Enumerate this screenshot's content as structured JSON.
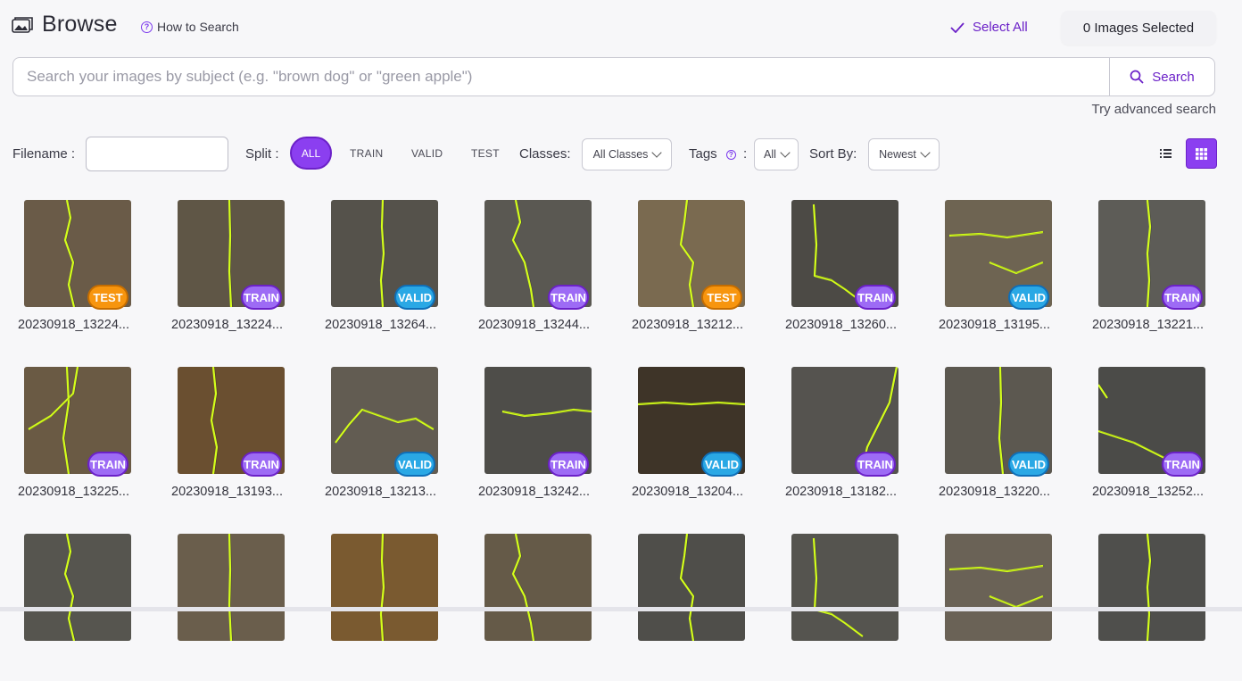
{
  "header": {
    "title": "Browse",
    "how_to_search": "How to Search",
    "select_all": "Select All",
    "selected_count": "0 Images Selected"
  },
  "search": {
    "placeholder": "Search your images by subject (e.g. \"brown dog\" or \"green apple\")",
    "value": "",
    "button_label": "Search",
    "advanced_link": "Try advanced search"
  },
  "filters": {
    "filename_label": "Filename :",
    "filename_value": "",
    "split_label": "Split :",
    "split_options": [
      "ALL",
      "TRAIN",
      "VALID",
      "TEST"
    ],
    "split_selected": "ALL",
    "classes_label": "Classes:",
    "classes_value": "All Classes",
    "tags_label": "Tags",
    "tags_colon": ":",
    "tags_value": "All",
    "sort_label": "Sort By:",
    "sort_value": "Newest"
  },
  "colors": {
    "accent": "#8b3ff0",
    "accent_dark": "#6b21c8",
    "train": "#9d6bf5",
    "valid": "#2aa8e5",
    "test": "#f7950e",
    "annotation": "#d4ff1a"
  },
  "images": [
    {
      "name": "20230918_13224...",
      "split": "TEST",
      "bg": "#6a5b48"
    },
    {
      "name": "20230918_13224...",
      "split": "TRAIN",
      "bg": "#5f5646"
    },
    {
      "name": "20230918_13264...",
      "split": "VALID",
      "bg": "#55524b"
    },
    {
      "name": "20230918_13244...",
      "split": "TRAIN",
      "bg": "#5a5852"
    },
    {
      "name": "20230918_13212...",
      "split": "TEST",
      "bg": "#7a6a50"
    },
    {
      "name": "20230918_13260...",
      "split": "TRAIN",
      "bg": "#4c4a45"
    },
    {
      "name": "20230918_13195...",
      "split": "VALID",
      "bg": "#6e6452"
    },
    {
      "name": "20230918_13221...",
      "split": "TRAIN",
      "bg": "#5d5c57"
    },
    {
      "name": "20230918_13225...",
      "split": "TRAIN",
      "bg": "#6a5a44"
    },
    {
      "name": "20230918_13193...",
      "split": "TRAIN",
      "bg": "#6a4f30"
    },
    {
      "name": "20230918_13213...",
      "split": "VALID",
      "bg": "#625c52"
    },
    {
      "name": "20230918_13242...",
      "split": "TRAIN",
      "bg": "#4e4d49"
    },
    {
      "name": "20230918_13204...",
      "split": "VALID",
      "bg": "#3e3428"
    },
    {
      "name": "20230918_13182...",
      "split": "TRAIN",
      "bg": "#55534f"
    },
    {
      "name": "20230918_13220...",
      "split": "VALID",
      "bg": "#5c5850"
    },
    {
      "name": "20230918_13252...",
      "split": "TRAIN",
      "bg": "#4b4b48"
    },
    {
      "name": "",
      "split": "",
      "bg": "#56554f"
    },
    {
      "name": "",
      "split": "",
      "bg": "#6a5e4c"
    },
    {
      "name": "",
      "split": "",
      "bg": "#7a5a30"
    },
    {
      "name": "",
      "split": "",
      "bg": "#655a48"
    },
    {
      "name": "",
      "split": "",
      "bg": "#4f4e4a"
    },
    {
      "name": "",
      "split": "",
      "bg": "#55544f"
    },
    {
      "name": "",
      "split": "",
      "bg": "#6a6256"
    },
    {
      "name": "",
      "split": "",
      "bg": "#4f4f4c"
    }
  ]
}
